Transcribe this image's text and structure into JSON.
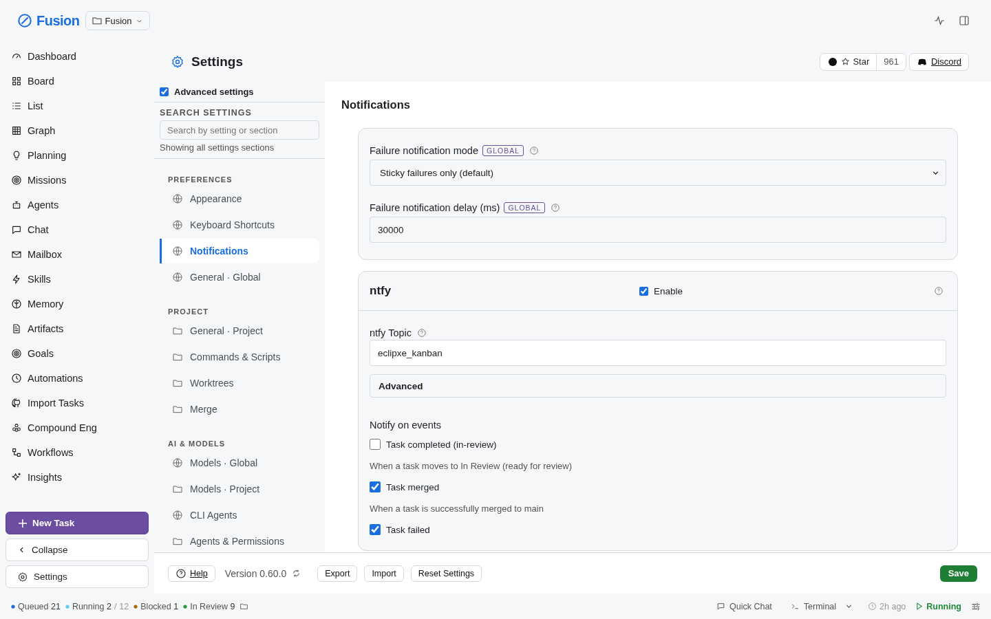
{
  "app": {
    "name": "Fusion",
    "project": "Fusion"
  },
  "sidebar": {
    "items": [
      {
        "label": "Dashboard",
        "selected": false
      },
      {
        "label": "Board",
        "selected": false
      },
      {
        "label": "List",
        "selected": false
      },
      {
        "label": "Graph",
        "selected": false
      },
      {
        "label": "Planning",
        "selected": false
      },
      {
        "label": "Missions",
        "selected": false
      },
      {
        "label": "Agents",
        "selected": false
      },
      {
        "label": "Chat",
        "selected": false
      },
      {
        "label": "Mailbox",
        "selected": false
      },
      {
        "label": "Skills",
        "selected": false
      },
      {
        "label": "Memory",
        "selected": false
      },
      {
        "label": "Artifacts",
        "selected": false
      },
      {
        "label": "Goals",
        "selected": false
      },
      {
        "label": "Automations",
        "selected": false
      },
      {
        "label": "Import Tasks",
        "selected": false
      },
      {
        "label": "Compound Eng",
        "selected": false
      },
      {
        "label": "Workflows",
        "selected": false
      },
      {
        "label": "Insights",
        "selected": false
      }
    ],
    "new_task": "New Task",
    "collapse": "Collapse",
    "settings": "Settings"
  },
  "header": {
    "title": "Settings",
    "star": "Star",
    "star_count": "961",
    "discord": "Discord"
  },
  "settings_nav": {
    "advanced": {
      "label": "Advanced settings",
      "checked": true
    },
    "search_heading": "SEARCH SETTINGS",
    "search_placeholder": "Search by setting or section",
    "search_note": "Showing all settings sections",
    "groups": [
      {
        "title": "PREFERENCES",
        "items": [
          {
            "label": "Appearance",
            "kind": "global",
            "selected": false
          },
          {
            "label": "Keyboard Shortcuts",
            "kind": "global",
            "selected": false
          },
          {
            "label": "Notifications",
            "kind": "global",
            "selected": true
          },
          {
            "label": "General · Global",
            "kind": "global",
            "selected": false
          }
        ]
      },
      {
        "title": "PROJECT",
        "items": [
          {
            "label": "General · Project",
            "kind": "project",
            "selected": false
          },
          {
            "label": "Commands & Scripts",
            "kind": "project",
            "selected": false
          },
          {
            "label": "Worktrees",
            "kind": "project",
            "selected": false
          },
          {
            "label": "Merge",
            "kind": "project",
            "selected": false
          }
        ]
      },
      {
        "title": "AI & MODELS",
        "items": [
          {
            "label": "Models · Global",
            "kind": "global",
            "selected": false
          },
          {
            "label": "Models · Project",
            "kind": "project",
            "selected": false
          },
          {
            "label": "CLI Agents",
            "kind": "global",
            "selected": false
          },
          {
            "label": "Agents & Permissions",
            "kind": "project",
            "selected": false
          }
        ]
      }
    ]
  },
  "content": {
    "title": "Notifications",
    "failure_fields": [
      {
        "kind": "select",
        "label": "Failure notification mode",
        "badge": "GLOBAL",
        "value": "Sticky failures only (default)"
      },
      {
        "kind": "input",
        "label": "Failure notification delay (ms)",
        "badge": "GLOBAL",
        "value": "30000"
      }
    ],
    "ntfy": {
      "title": "ntfy",
      "enable_label": "Enable",
      "enabled": true,
      "topic_label": "ntfy Topic",
      "topic_value": "eclipxe_kanban",
      "advanced": "Advanced",
      "events_heading": "Notify on events",
      "events": [
        {
          "label": "Task completed (in-review)",
          "checked": false,
          "description": "When a task moves to In Review (ready for review)"
        },
        {
          "label": "Task merged",
          "checked": true,
          "description": "When a task is successfully merged to main"
        },
        {
          "label": "Task failed",
          "checked": true
        }
      ]
    }
  },
  "footer": {
    "help": "Help",
    "version": "Version 0.60.0",
    "buttons": [
      "Export",
      "Import",
      "Reset Settings"
    ],
    "save": "Save"
  },
  "status_bar": {
    "counts": [
      {
        "label": "Queued",
        "value": "21",
        "color": "#1a6fe0"
      },
      {
        "label": "Running",
        "value": "2",
        "separator": "/",
        "total": "12",
        "color": "#5bcfe6"
      },
      {
        "label": "Blocked",
        "value": "1",
        "color": "#a86a00"
      },
      {
        "label": "In Review",
        "value": "9",
        "color": "#1f9d40"
      }
    ],
    "quick_chat": "Quick Chat",
    "terminal": "Terminal",
    "last_run": "2h ago",
    "engine_state": "Running"
  }
}
